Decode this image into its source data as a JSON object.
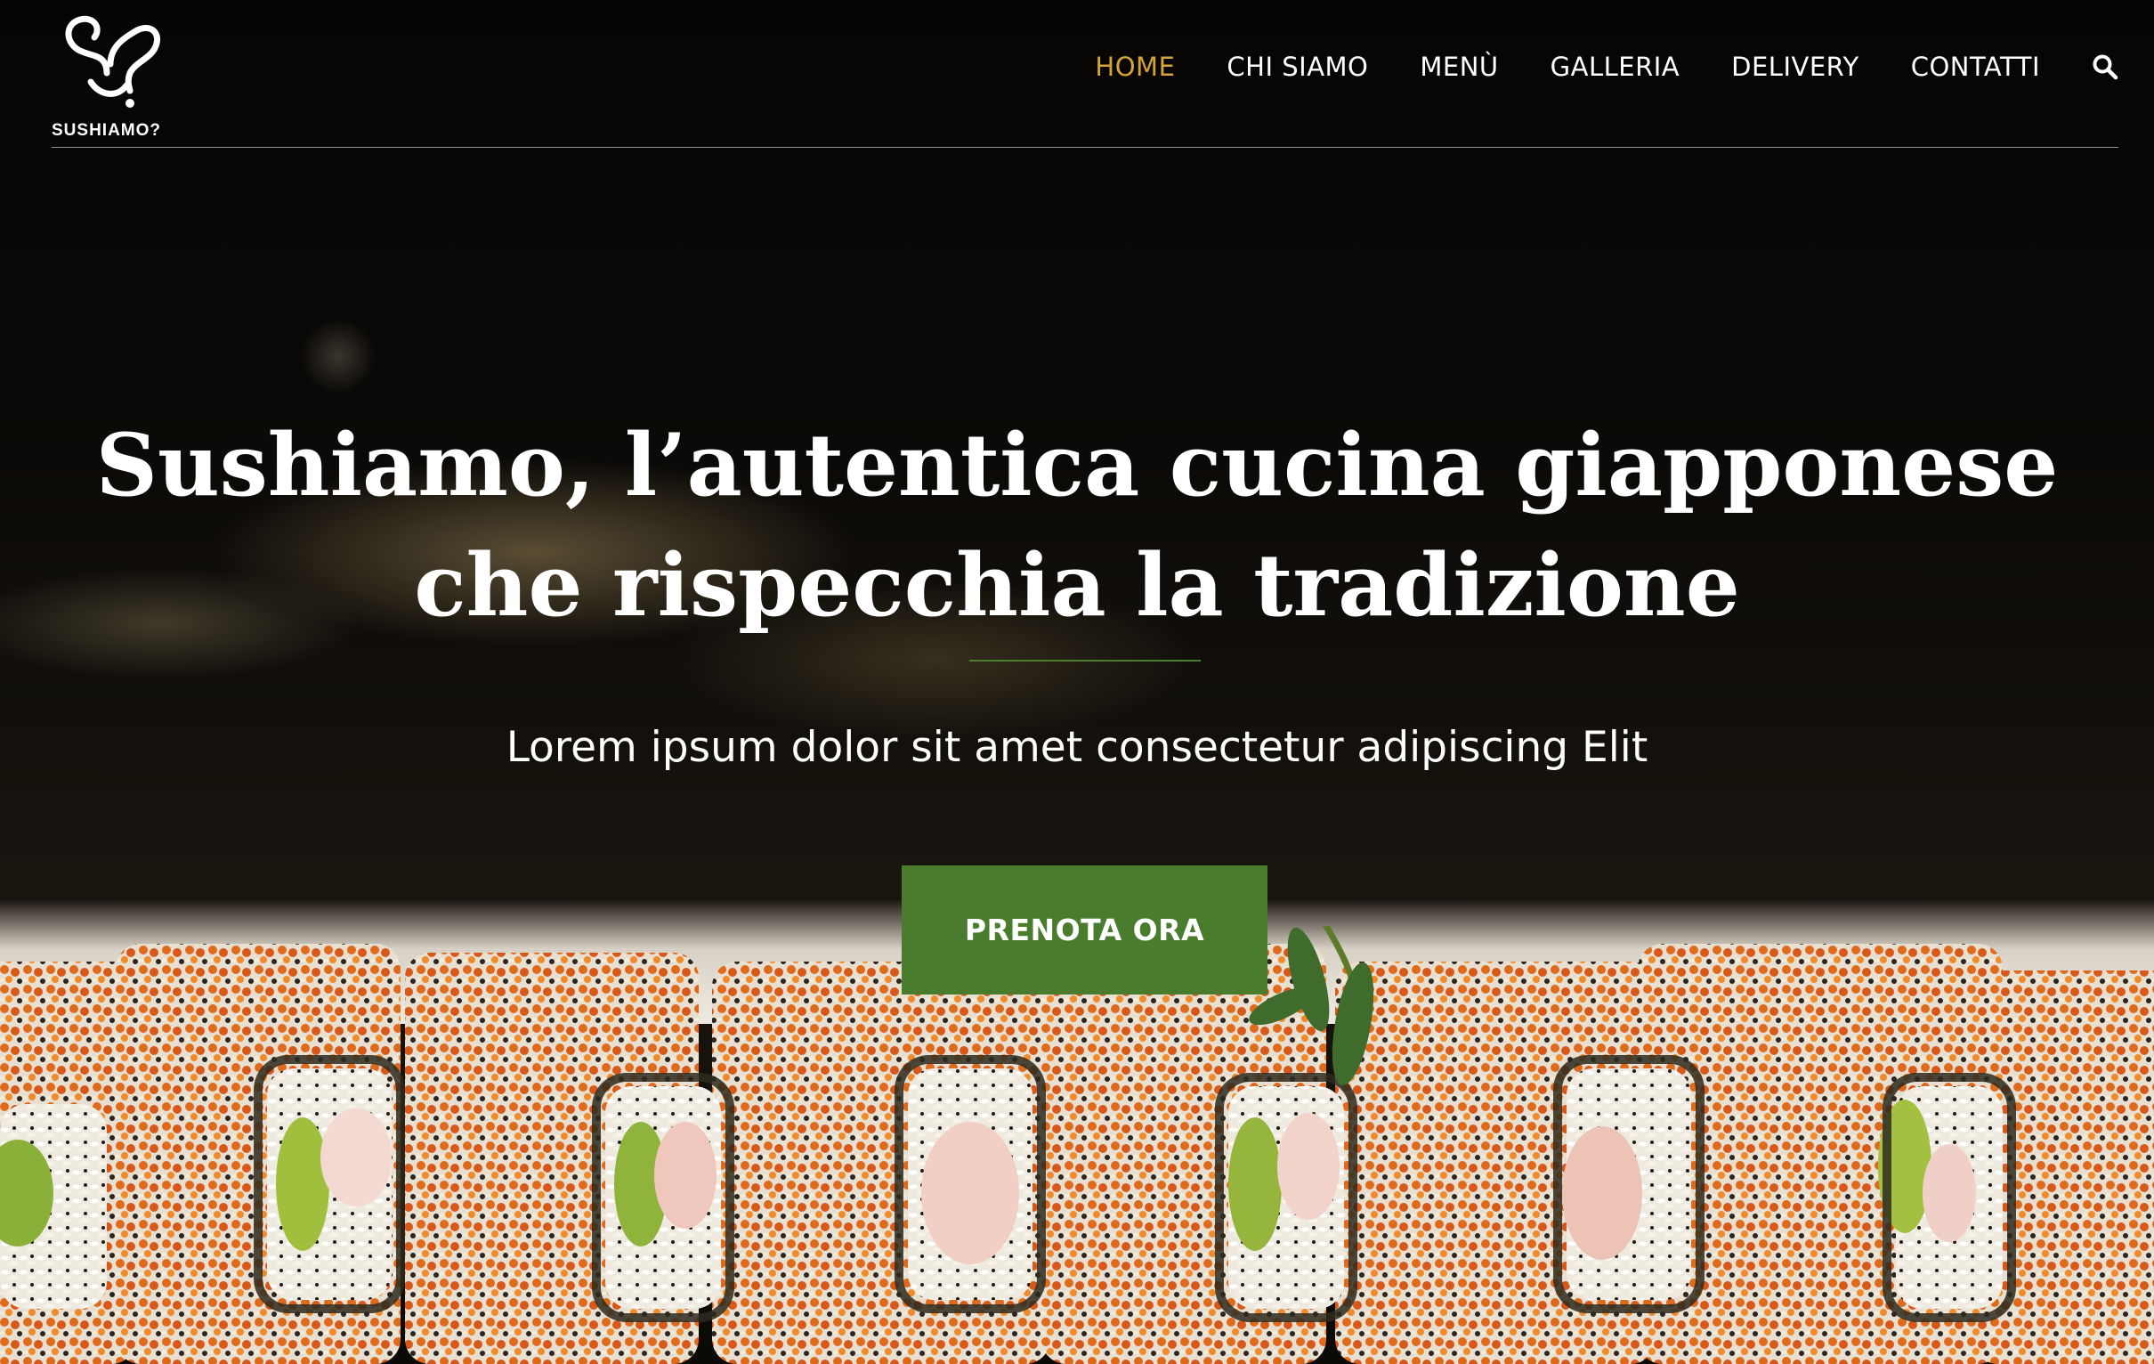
{
  "header": {
    "logo_text": "SUSHIAMO?",
    "nav": [
      {
        "label": "HOME",
        "active": true
      },
      {
        "label": "CHI SIAMO",
        "active": false
      },
      {
        "label": "MENÙ",
        "active": false
      },
      {
        "label": "GALLERIA",
        "active": false
      },
      {
        "label": "DELIVERY",
        "active": false
      },
      {
        "label": "CONTATTI",
        "active": false
      }
    ],
    "search_icon": "search-icon"
  },
  "hero": {
    "title_line1": "Sushiamo, l’autentica cucina giapponese",
    "title_line2": "che rispecchia la tradizione",
    "subtitle": "Lorem ipsum dolor sit amet consectetur adipiscing Elit",
    "cta_label": "PRENOTA ORA"
  },
  "colors": {
    "accent_gold": "#d4a33a",
    "brand_green": "#4a7c2e",
    "text": "#ffffff",
    "background": "#0a0806"
  }
}
